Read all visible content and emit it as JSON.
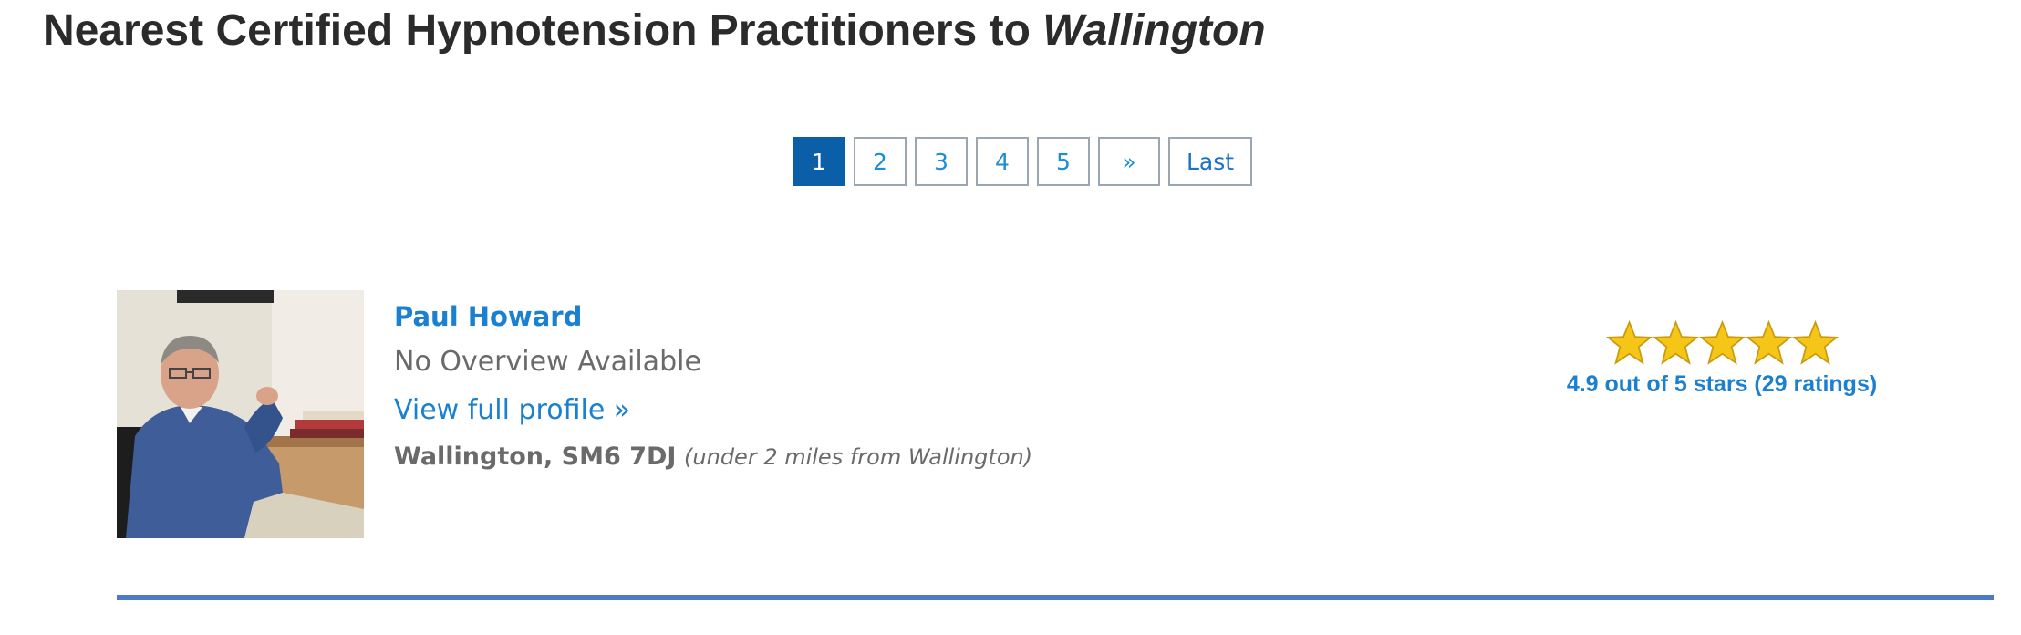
{
  "header": {
    "title_prefix": "Nearest Certified Hypnotension Practitioners to",
    "title_location": "Wallington"
  },
  "pagination": {
    "pages": [
      "1",
      "2",
      "3",
      "4",
      "5"
    ],
    "current_page": "1",
    "next_label": "»",
    "last_label": "Last"
  },
  "result": {
    "name": "Paul Howard",
    "overview": "No Overview Available",
    "profile_link": "View full profile »",
    "town": "Wallington, SM6 7DJ",
    "distance": "(under 2 miles from Wallington)",
    "rating": {
      "stars_filled": 5,
      "stars_total": 5,
      "text": "4.9 out of 5 stars (29 ratings)"
    }
  },
  "colors": {
    "accent": "#1a80cf",
    "active_page": "#0b5ea8",
    "star": "#f5c518",
    "divider": "#4c7ac6"
  }
}
